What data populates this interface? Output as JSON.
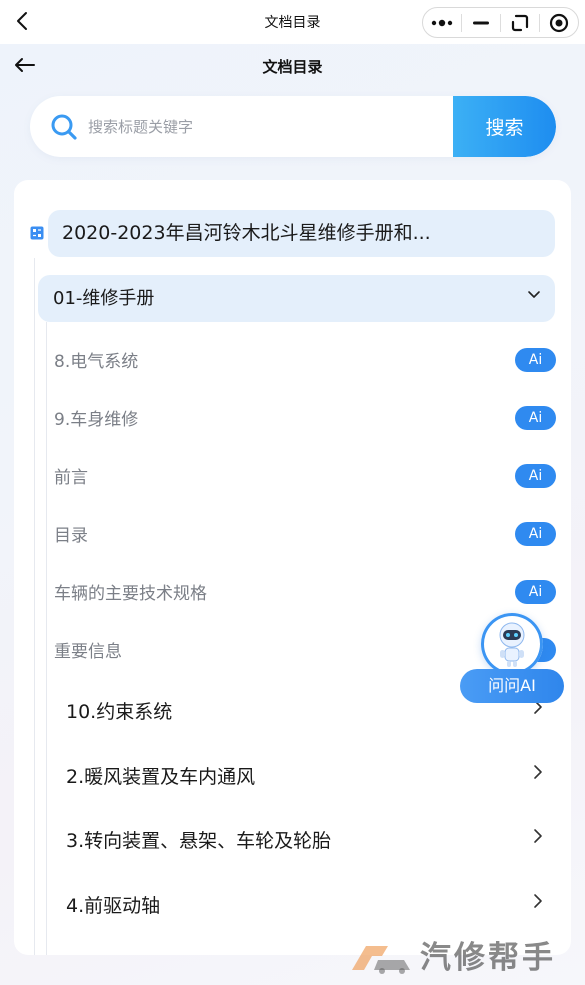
{
  "window": {
    "title": "文档目录"
  },
  "header": {
    "title": "文档目录"
  },
  "search": {
    "placeholder": "搜索标题关键字",
    "button_label": "搜索"
  },
  "document": {
    "title": "2020-2023年昌河铃木北斗星维修手册和..."
  },
  "folder": {
    "label": "01-维修手册"
  },
  "leaf_items": [
    {
      "label": "8.电气系统",
      "badge": "Ai"
    },
    {
      "label": "9.车身维修",
      "badge": "Ai"
    },
    {
      "label": "前言",
      "badge": "Ai"
    },
    {
      "label": "目录",
      "badge": "Ai"
    },
    {
      "label": "车辆的主要技术规格",
      "badge": "Ai"
    },
    {
      "label": "重要信息",
      "badge": "Ai"
    }
  ],
  "sub_folders": [
    {
      "label": "10.约束系统"
    },
    {
      "label": "2.暖风装置及车内通风"
    },
    {
      "label": "3.转向装置、悬架、车轮及轮胎"
    },
    {
      "label": "4.前驱动轴"
    }
  ],
  "assistant": {
    "label": "问问AI"
  },
  "watermark": {
    "text": "汽修帮手"
  },
  "colors": {
    "accent": "#2f8af0",
    "highlight_bg": "#e4effb",
    "muted_text": "#7b7f87"
  },
  "icons": {
    "wx_back": "chevron-left-icon",
    "more": "more-dots-icon",
    "minimize": "minimize-icon",
    "float": "float-window-icon",
    "close": "close-circle-icon",
    "page_back": "arrow-left-icon",
    "search": "search-icon",
    "doc": "document-icon",
    "expand": "chevron-down-icon",
    "open": "chevron-right-icon",
    "robot": "robot-avatar-icon"
  }
}
